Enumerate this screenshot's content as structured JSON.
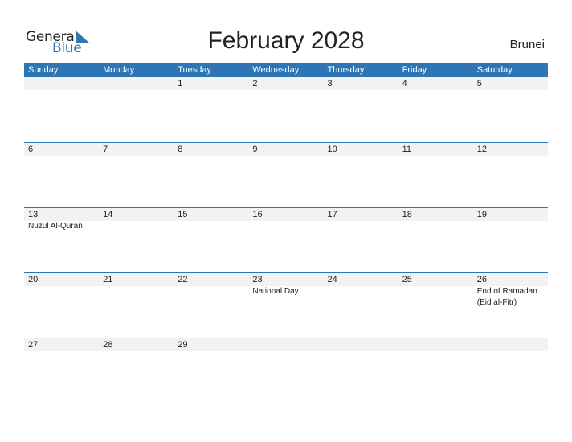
{
  "logo": {
    "word1": "General",
    "word2": "Blue"
  },
  "title": "February 2028",
  "country": "Brunei",
  "colors": {
    "accent": "#2e75b6",
    "strip": "#f2f2f2"
  },
  "weekdays": [
    "Sunday",
    "Monday",
    "Tuesday",
    "Wednesday",
    "Thursday",
    "Friday",
    "Saturday"
  ],
  "weeks": [
    [
      {
        "d": ""
      },
      {
        "d": ""
      },
      {
        "d": "1"
      },
      {
        "d": "2"
      },
      {
        "d": "3"
      },
      {
        "d": "4"
      },
      {
        "d": "5"
      }
    ],
    [
      {
        "d": "6"
      },
      {
        "d": "7"
      },
      {
        "d": "8"
      },
      {
        "d": "9"
      },
      {
        "d": "10"
      },
      {
        "d": "11"
      },
      {
        "d": "12"
      }
    ],
    [
      {
        "d": "13",
        "e": [
          "Nuzul Al-Quran"
        ]
      },
      {
        "d": "14"
      },
      {
        "d": "15"
      },
      {
        "d": "16"
      },
      {
        "d": "17"
      },
      {
        "d": "18"
      },
      {
        "d": "19"
      }
    ],
    [
      {
        "d": "20"
      },
      {
        "d": "21"
      },
      {
        "d": "22"
      },
      {
        "d": "23",
        "e": [
          "National Day"
        ]
      },
      {
        "d": "24"
      },
      {
        "d": "25"
      },
      {
        "d": "26",
        "e": [
          "End of Ramadan",
          "(Eid al-Fitr)"
        ]
      }
    ],
    [
      {
        "d": "27"
      },
      {
        "d": "28"
      },
      {
        "d": "29"
      },
      {
        "d": ""
      },
      {
        "d": ""
      },
      {
        "d": ""
      },
      {
        "d": ""
      }
    ]
  ]
}
